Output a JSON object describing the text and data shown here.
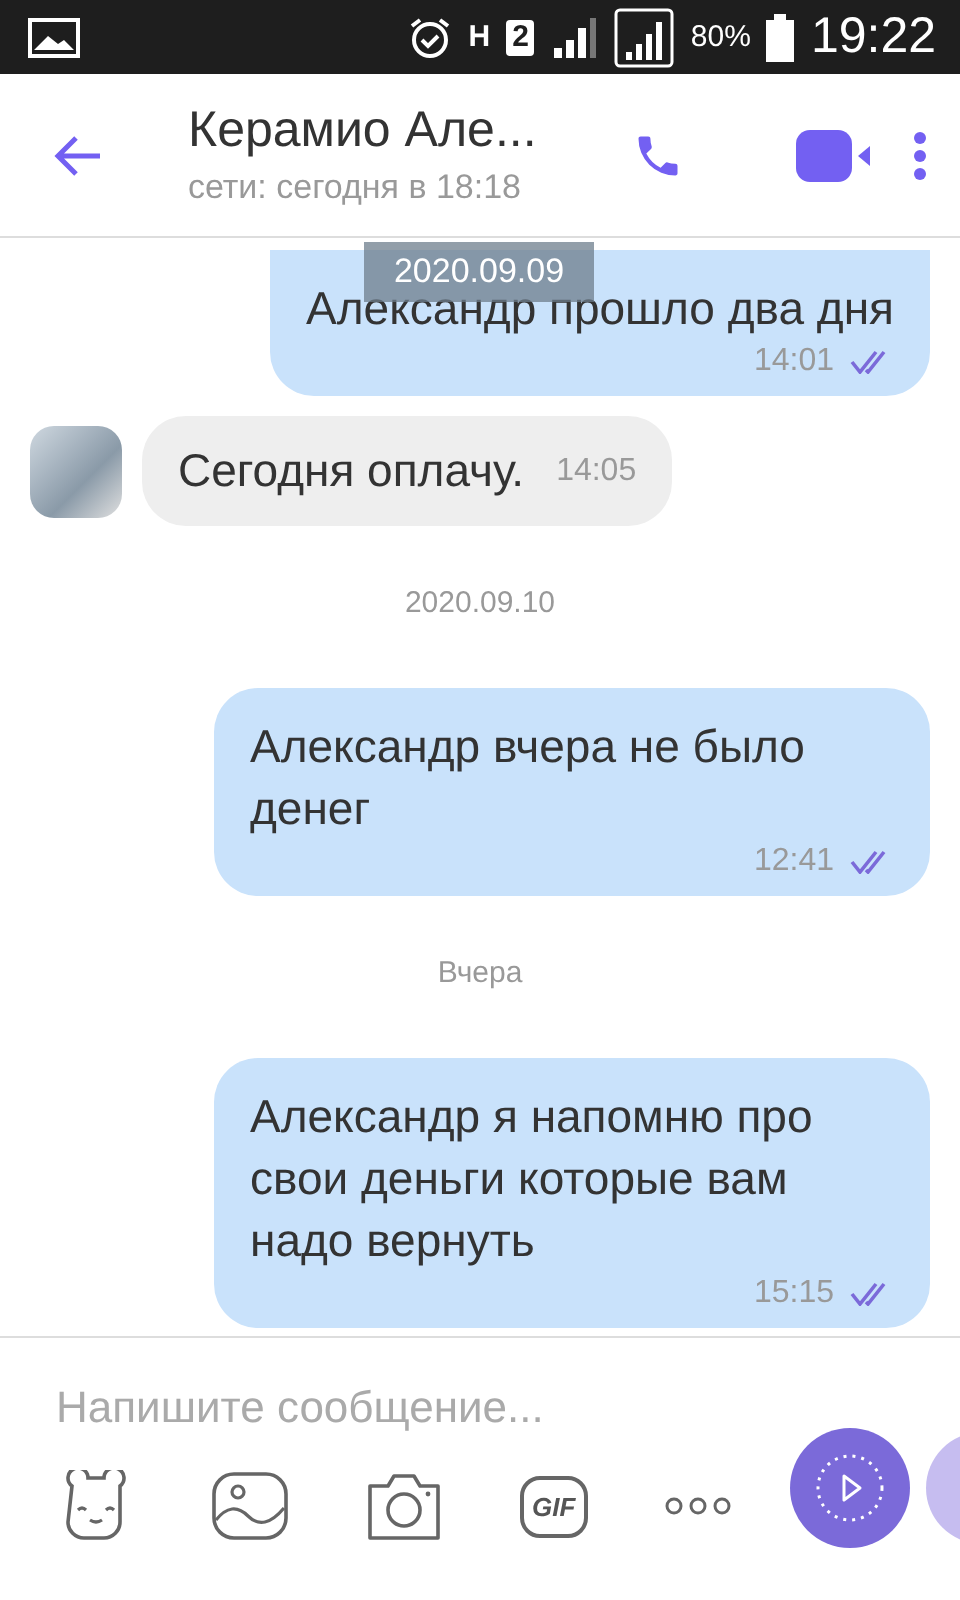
{
  "status_bar": {
    "network": "H",
    "sim": "2",
    "battery": "80%",
    "time": "19:22"
  },
  "header": {
    "title": "Керамио Але...",
    "subtitle": "сети: сегодня в 18:18"
  },
  "sticky_date": "2020.09.09",
  "messages": [
    {
      "kind": "sent",
      "text": "Александр прошло два дня",
      "time": "14:01",
      "cut_top": true
    },
    {
      "kind": "received",
      "text": "Сегодня оплачу.",
      "time": "14:05"
    },
    {
      "kind": "date",
      "text": "2020.09.10"
    },
    {
      "kind": "sent",
      "text": "Александр вчера не было денег",
      "time": "12:41"
    },
    {
      "kind": "date",
      "text": "Вчера"
    },
    {
      "kind": "sent",
      "text": "Александр я напомню про свои деньги которые вам надо вернуть",
      "time": "15:15"
    }
  ],
  "composer": {
    "placeholder": "Напишите сообщение...",
    "gif_label": "GIF"
  }
}
